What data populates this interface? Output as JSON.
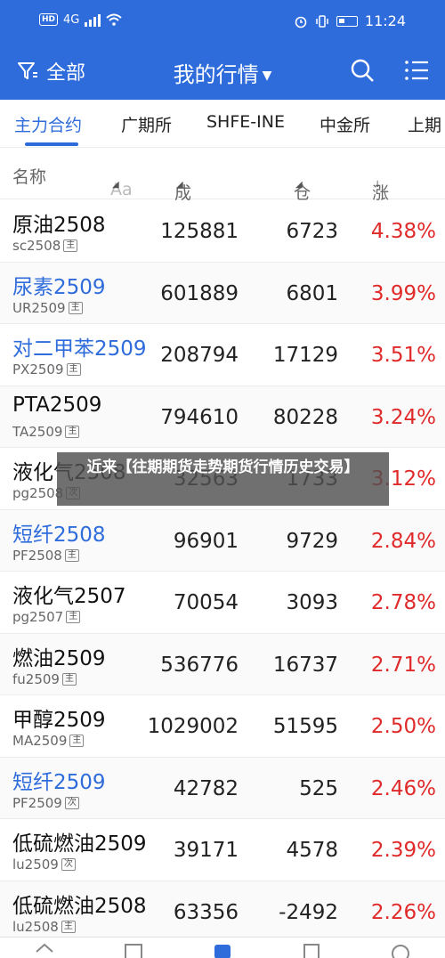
{
  "status": {
    "carrier": "4G",
    "time": "11:24",
    "colors": {
      "header_bg": "#2f6cdb",
      "up": "#e02a2a",
      "link": "#2f6cdb"
    }
  },
  "nav": {
    "filter_label": "全部",
    "title": "我的行情",
    "icons": [
      "filter-icon",
      "search-icon",
      "menu-icon"
    ]
  },
  "tabs": [
    "主力合约",
    "广期所",
    "SHFE-INE",
    "中金所",
    "上期"
  ],
  "columns": {
    "name": "名称",
    "aa": "Aa",
    "volume": "成交量",
    "oi_change": "仓差",
    "pct": "涨跌幅"
  },
  "rows": [
    {
      "name": "原油2508",
      "code": "sc2508",
      "tag": "主",
      "volume": "125881",
      "oi": "6723",
      "pct": "4.38%",
      "blue": false
    },
    {
      "name": "尿素2509",
      "code": "UR2509",
      "tag": "主",
      "volume": "601889",
      "oi": "6801",
      "pct": "3.99%",
      "blue": true
    },
    {
      "name": "对二甲苯2509",
      "code": "PX2509",
      "tag": "主",
      "volume": "208794",
      "oi": "17129",
      "pct": "3.51%",
      "blue": true
    },
    {
      "name": "PTA2509",
      "code": "TA2509",
      "tag": "主",
      "volume": "794610",
      "oi": "80228",
      "pct": "3.24%",
      "blue": false
    },
    {
      "name": "液化气2508",
      "code": "pg2508",
      "tag": "次",
      "volume": "32563",
      "oi": "1733",
      "pct": "3.12%",
      "blue": false
    },
    {
      "name": "短纤2508",
      "code": "PF2508",
      "tag": "主",
      "volume": "96901",
      "oi": "9729",
      "pct": "2.84%",
      "blue": true
    },
    {
      "name": "液化气2507",
      "code": "pg2507",
      "tag": "主",
      "volume": "70054",
      "oi": "3093",
      "pct": "2.78%",
      "blue": false
    },
    {
      "name": "燃油2509",
      "code": "fu2509",
      "tag": "主",
      "volume": "536776",
      "oi": "16737",
      "pct": "2.71%",
      "blue": false
    },
    {
      "name": "甲醇2509",
      "code": "MA2509",
      "tag": "主",
      "volume": "1029002",
      "oi": "51595",
      "pct": "2.50%",
      "blue": false
    },
    {
      "name": "短纤2509",
      "code": "PF2509",
      "tag": "次",
      "volume": "42782",
      "oi": "525",
      "pct": "2.46%",
      "blue": true
    },
    {
      "name": "低硫燃油2509",
      "code": "lu2509",
      "tag": "次",
      "volume": "39171",
      "oi": "4578",
      "pct": "2.39%",
      "blue": false
    },
    {
      "name": "低硫燃油2508",
      "code": "lu2508",
      "tag": "主",
      "volume": "63356",
      "oi": "-2492",
      "pct": "2.26%",
      "blue": false
    }
  ],
  "overlay": {
    "text": "近来【往期期货走势期货行情历史交易】"
  }
}
